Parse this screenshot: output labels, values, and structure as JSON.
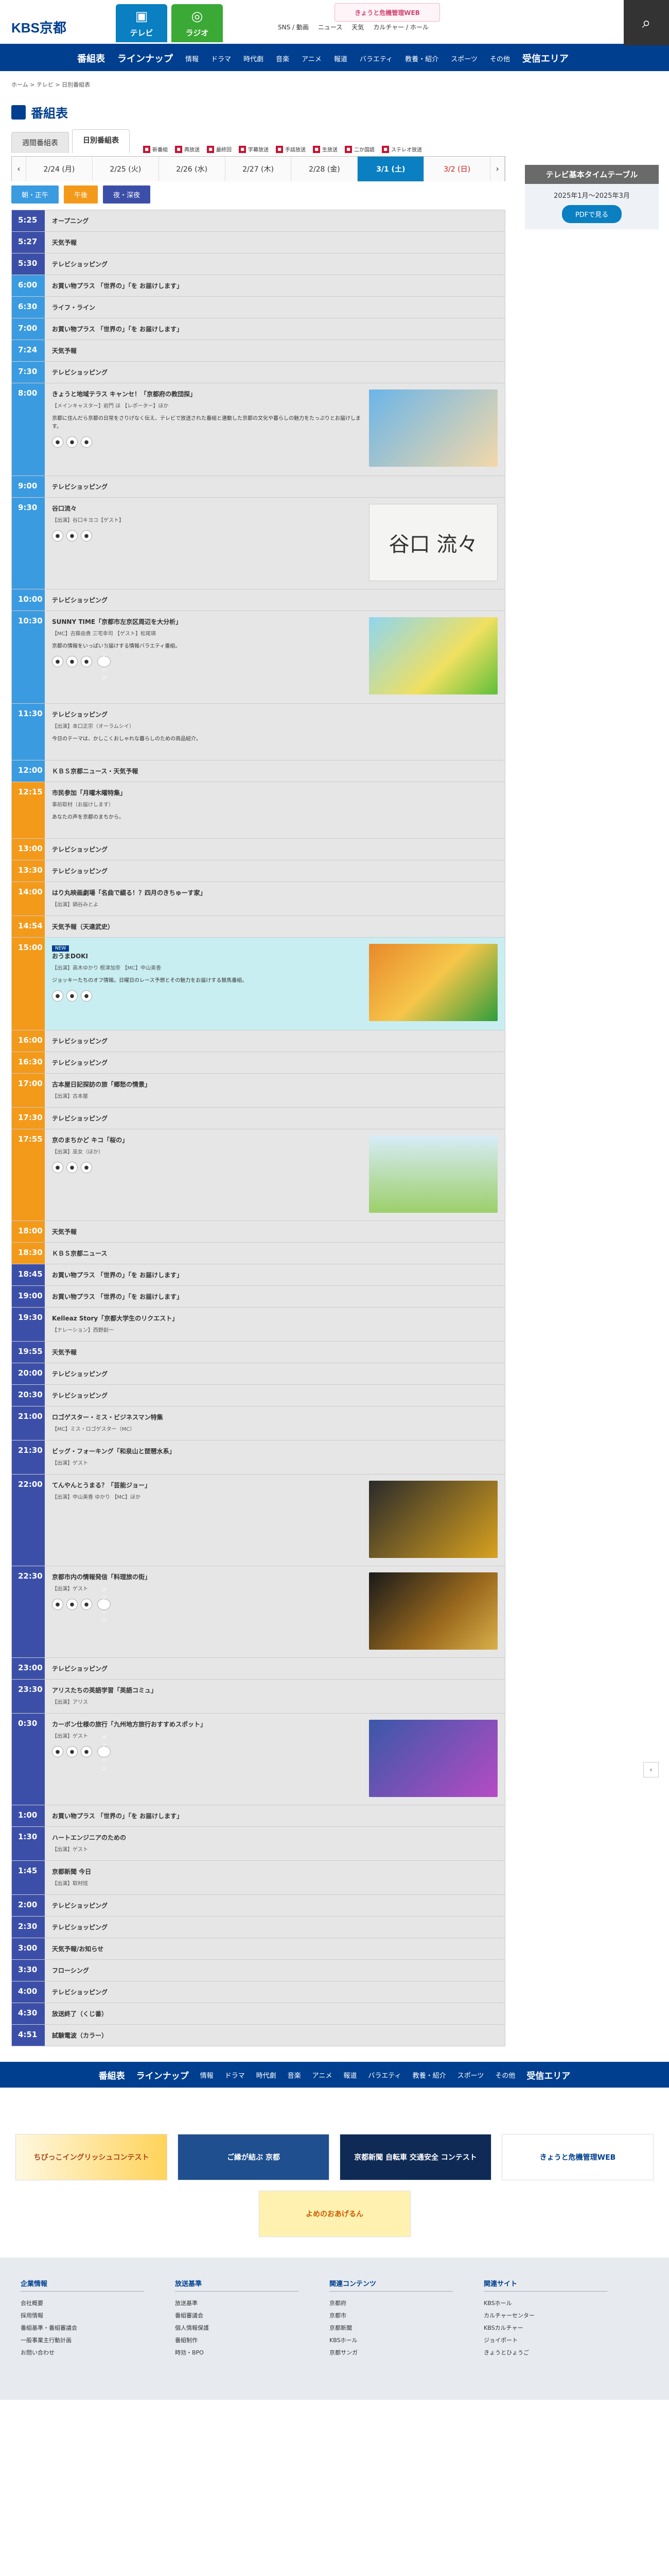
{
  "header": {
    "logo": "KBS京都",
    "logo_sub": "",
    "tv_label": "テレビ",
    "radio_label": "ラジオ",
    "tv_icon": "tv-icon",
    "radio_icon": "radio-icon",
    "util": [
      "SNS / 動画",
      "ニュース",
      "天気",
      "カルチャー / ホール"
    ],
    "banner": "きょうと危機管理WEB"
  },
  "subnav": {
    "items": [
      "番組表",
      "ラインナップ",
      "情報",
      "ドラマ",
      "時代劇",
      "音楽",
      "アニメ",
      "報道",
      "バラエティ",
      "教養・紹介",
      "スポーツ",
      "その他",
      "受信エリア"
    ]
  },
  "breadcrumb": "ホーム > テレビ > 日別番組表",
  "page": {
    "title": "番組表"
  },
  "tabs": [
    "週間番組表",
    "日別番組表"
  ],
  "legend": [
    "新番組",
    "再放送",
    "最終回",
    "字幕放送",
    "手話放送",
    "生放送",
    "二か国語",
    "ステレオ放送"
  ],
  "side": {
    "title": "テレビ基本タイムテーブル",
    "period": "2025年1月〜2025年3月",
    "pdf": "PDFで見る"
  },
  "dates": [
    "2/24 (月)",
    "2/25 (火)",
    "2/26 (水)",
    "2/27 (木)",
    "2/28 (金)",
    "3/1 (土)",
    "3/2 (日)"
  ],
  "filters": [
    "朝・正午",
    "午後",
    "夜・深夜"
  ],
  "schedule": [
    {
      "t": "5:25",
      "p": "c-night",
      "title": "オープニング"
    },
    {
      "t": "5:27",
      "p": "c-night",
      "title": "天気予報"
    },
    {
      "t": "5:30",
      "p": "c-night",
      "title": "テレビショッピング"
    },
    {
      "t": "6:00",
      "p": "c-morn",
      "title": "お買い物プラス 「世界の」「を お届けします」"
    },
    {
      "t": "6:30",
      "p": "c-morn",
      "title": "ライフ・ライン"
    },
    {
      "t": "7:00",
      "p": "c-morn",
      "title": "お買い物プラス 「世界の」「を お届けします」"
    },
    {
      "t": "7:24",
      "p": "c-morn",
      "title": "天気予報"
    },
    {
      "t": "7:30",
      "p": "c-morn",
      "title": "テレビショッピング"
    },
    {
      "t": "8:00",
      "p": "c-morn",
      "title": "きょうと地域テラス キャンセ！「京都府の教団探」",
      "desc": "【メインキャスター】岩門 ほ  【レポーター】ほか",
      "detail": "京都に住んだら京都の日常をさりげなく伝え、テレビで放送された番組と連動した京都の文化や暮らしの魅力をたっぷりとお届けします。",
      "thumb": "th1",
      "sns": true
    },
    {
      "t": "9:00",
      "p": "c-morn",
      "title": "テレビショッピング"
    },
    {
      "t": "9:30",
      "p": "c-morn",
      "title": "谷口流々",
      "desc": "【出演】谷口キヨコ【ゲスト】",
      "thumb": "th2",
      "thumb_text": "谷口 流々",
      "sns": true
    },
    {
      "t": "10:00",
      "p": "c-morn",
      "title": "テレビショッピング"
    },
    {
      "t": "10:30",
      "p": "c-morn",
      "title": "SUNNY TIME「京都市左京区周辺を大分析」",
      "desc": "【MC】古藤由貴  三宅幸司  【ゲスト】松尾瑛",
      "detail": "京都の情報をいっぱいお届けする情報バラエティ番組。",
      "thumb": "th3",
      "sns": true,
      "msg": "メッセージ"
    },
    {
      "t": "11:30",
      "p": "c-morn",
      "title": "テレビショッピング",
      "desc": "【出演】本口正宗（オーラムシイ）",
      "detail": "今日のテーマは、かしこくおしゃれな暮らしのための商品紹介。"
    },
    {
      "t": "12:00",
      "p": "c-morn",
      "title": "ＫＢＳ京都ニュース・天気予報"
    },
    {
      "t": "12:15",
      "p": "c-day",
      "title": "市民参加「月曜木曜特集」",
      "desc": "事前取材（お届けします）",
      "detail": "あなたの声を京都のまちから。"
    },
    {
      "t": "13:00",
      "p": "c-day",
      "title": "テレビショッピング"
    },
    {
      "t": "13:30",
      "p": "c-day",
      "title": "テレビショッピング"
    },
    {
      "t": "14:00",
      "p": "c-day",
      "title": "はり丸映画劇場「名曲で綴る！？四月のきちゅーす家」",
      "desc": "【出演】鍋谷みとよ"
    },
    {
      "t": "14:54",
      "p": "c-day",
      "title": "天気予報（天達武史）"
    },
    {
      "t": "15:00",
      "p": "c-day",
      "title": "おうまDOKI",
      "tag": "NEW",
      "desc": "【出演】高木ゆかり  根津加奈  【MC】中山美香",
      "detail": "ジョッキーたちのオフ情報。日曜日のレース予想とその魅力をお届けする競馬番組。",
      "thumb": "th4",
      "hi": true,
      "sns": true
    },
    {
      "t": "16:00",
      "p": "c-day",
      "title": "テレビショッピング"
    },
    {
      "t": "16:30",
      "p": "c-day",
      "title": "テレビショッピング"
    },
    {
      "t": "17:00",
      "p": "c-day",
      "title": "古本屋日記探訪の旅「郷愁の情景」",
      "desc": "【出演】古本屋"
    },
    {
      "t": "17:30",
      "p": "c-day",
      "title": "テレビショッピング"
    },
    {
      "t": "17:55",
      "p": "c-day",
      "title": "京のまちかど キコ「桜の」",
      "desc": "【出演】巫女（ほか）",
      "thumb": "th5",
      "sns": true
    },
    {
      "t": "18:00",
      "p": "c-day",
      "title": "天気予報"
    },
    {
      "t": "18:30",
      "p": "c-day",
      "title": "ＫＢＳ京都ニュース"
    },
    {
      "t": "18:45",
      "p": "c-night",
      "title": "お買い物プラス 「世界の」「を お届けします」"
    },
    {
      "t": "19:00",
      "p": "c-night",
      "title": "お買い物プラス 「世界の」「を お届けします」"
    },
    {
      "t": "19:30",
      "p": "c-night",
      "title": "Kelleaz Story「京都大学生のリクエスト」",
      "desc": "【ナレーション】西野創一"
    },
    {
      "t": "19:55",
      "p": "c-night",
      "title": "天気予報"
    },
    {
      "t": "20:00",
      "p": "c-night",
      "title": "テレビショッピング"
    },
    {
      "t": "20:30",
      "p": "c-night",
      "title": "テレビショッピング"
    },
    {
      "t": "21:00",
      "p": "c-night",
      "title": "ロゴゲスター・ミス・ビジネスマン特集",
      "desc": "【MC】ミス・ロゴゲスター（MC）"
    },
    {
      "t": "21:30",
      "p": "c-night",
      "title": "ビッグ・フォーキング「和泉山と琵琶水系」",
      "desc": "【出演】ゲスト"
    },
    {
      "t": "22:00",
      "p": "c-night",
      "title": "てんやんとうまる？「芸能ジョー」",
      "desc": "【出演】中山美香  ゆかり  【MC】ほか",
      "thumb": "th6"
    },
    {
      "t": "22:30",
      "p": "c-night",
      "title": "京都市内の情報発信「料理旅の街」",
      "desc": "【出演】ゲスト",
      "thumb": "th7",
      "sns": true,
      "msg": "メッセージ"
    },
    {
      "t": "23:00",
      "p": "c-night",
      "title": "テレビショッピング"
    },
    {
      "t": "23:30",
      "p": "c-night",
      "title": "アリスたちの英語学習「英語コミュ」",
      "desc": "【出演】アリス"
    },
    {
      "t": "0:30",
      "p": "c-night",
      "title": "カーボン仕様の旅行「九州地方旅行おすすめスポット」",
      "desc": "【出演】ゲスト",
      "thumb": "th8",
      "sns": true,
      "msg": "メッセージ"
    },
    {
      "t": "1:00",
      "p": "c-night",
      "title": "お買い物プラス 「世界の」「を お届けします」"
    },
    {
      "t": "1:30",
      "p": "c-night",
      "title": "ハートエンジニアのための",
      "desc": "【出演】ゲスト"
    },
    {
      "t": "1:45",
      "p": "c-night",
      "title": "京都新聞 今日",
      "desc": "【出演】取材班"
    },
    {
      "t": "2:00",
      "p": "c-night",
      "title": "テレビショッピング"
    },
    {
      "t": "2:30",
      "p": "c-night",
      "title": "テレビショッピング"
    },
    {
      "t": "3:00",
      "p": "c-night",
      "title": "天気予報/お知らせ"
    },
    {
      "t": "3:30",
      "p": "c-night",
      "title": "フローシング"
    },
    {
      "t": "4:00",
      "p": "c-night",
      "title": "テレビショッピング"
    },
    {
      "t": "4:30",
      "p": "c-night",
      "title": "放送終了（くじ番）"
    },
    {
      "t": "4:51",
      "p": "c-night",
      "title": "試験電波（カラー）"
    }
  ],
  "footnav": [
    "番組表",
    "ラインナップ",
    "情報",
    "ドラマ",
    "時代劇",
    "音楽",
    "アニメ",
    "報道",
    "バラエティ",
    "教養・紹介",
    "スポーツ",
    "その他",
    "受信エリア"
  ],
  "banners": [
    "ちびっこイングリッシュコンテスト",
    "ご縁が結ぶ 京都",
    "京都新聞 自転車 交通安全 コンテスト",
    "きょうと危機管理WEB",
    "よめのおあげるん"
  ],
  "footer": {
    "cols": [
      {
        "h": "企業情報",
        "items": [
          "会社概要",
          "採用情報",
          "番組基準・番組審議会",
          "一般事業主行動計画",
          "お問い合わせ"
        ]
      },
      {
        "h": "放送基準",
        "items": [
          "放送基準",
          "番組審議会",
          "個人情報保護",
          "番組制作",
          "時効・BPO"
        ]
      },
      {
        "h": "関連コンテンツ",
        "items": [
          "京都府",
          "京都市",
          "京都新聞",
          "KBSホール",
          "京都サンガ"
        ]
      },
      {
        "h": "関連サイト",
        "items": [
          "KBSホール",
          "カルチャーセンター",
          "KBSカルチャー",
          "ジョイポート",
          "きょうとひょうご"
        ]
      }
    ]
  }
}
